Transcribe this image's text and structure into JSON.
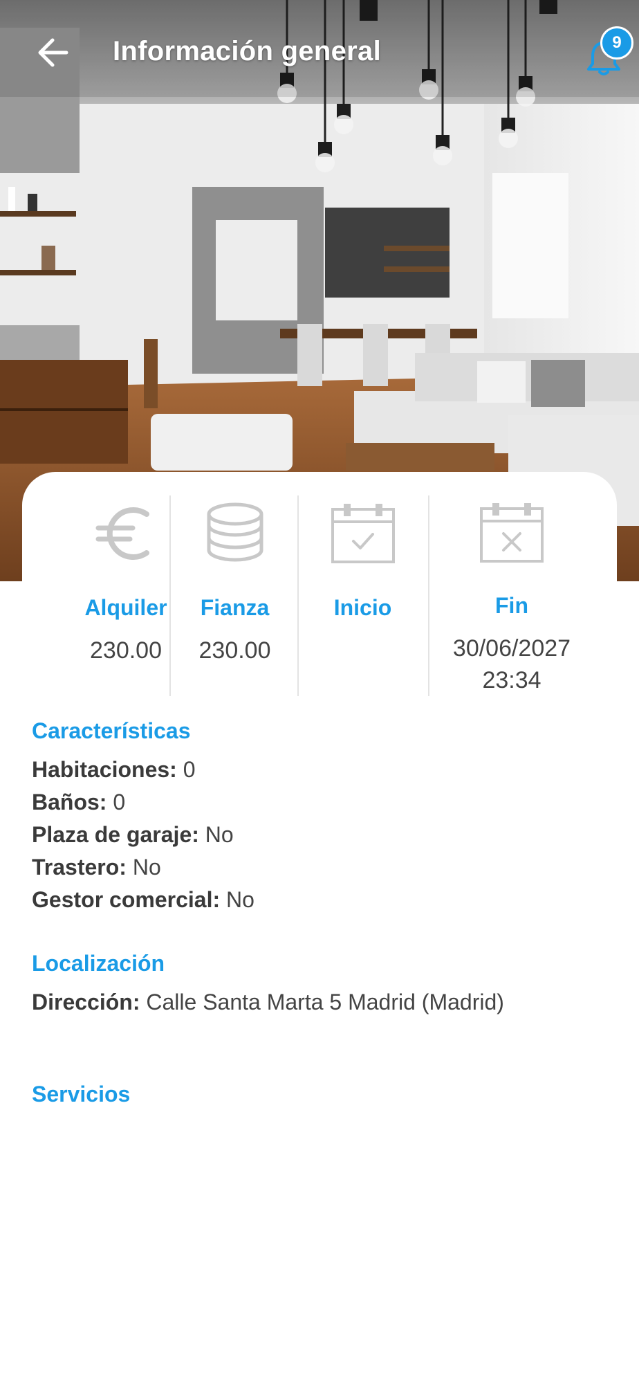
{
  "header": {
    "title": "Información general",
    "notifications_count": "9"
  },
  "summary": {
    "rent": {
      "label": "Alquiler",
      "value": "230.00"
    },
    "deposit": {
      "label": "Fianza",
      "value": "230.00"
    },
    "start": {
      "label": "Inicio",
      "value": ""
    },
    "end": {
      "label": "Fin",
      "value_date": "30/06/2027",
      "value_time": "23:34"
    }
  },
  "features": {
    "title": "Características",
    "rows": [
      {
        "key": "Habitaciones:",
        "value": "0"
      },
      {
        "key": "Baños:",
        "value": "0"
      },
      {
        "key": "Plaza de garaje:",
        "value": "No"
      },
      {
        "key": "Trastero:",
        "value": "No"
      },
      {
        "key": "Gestor comercial:",
        "value": "No"
      }
    ]
  },
  "location": {
    "title": "Localización",
    "address_key": "Dirección:",
    "address_value": "Calle Santa Marta 5 Madrid (Madrid)"
  },
  "services": {
    "title": "Servicios"
  },
  "icons": {
    "back": "arrow-left-icon",
    "notifications": "bell-icon",
    "rent": "euro-icon",
    "deposit": "coins-stack-icon",
    "start": "calendar-check-icon",
    "end": "calendar-x-icon"
  },
  "colors": {
    "accent": "#1a9be6",
    "icon_gray": "#c8c8c8",
    "text": "#444444"
  }
}
